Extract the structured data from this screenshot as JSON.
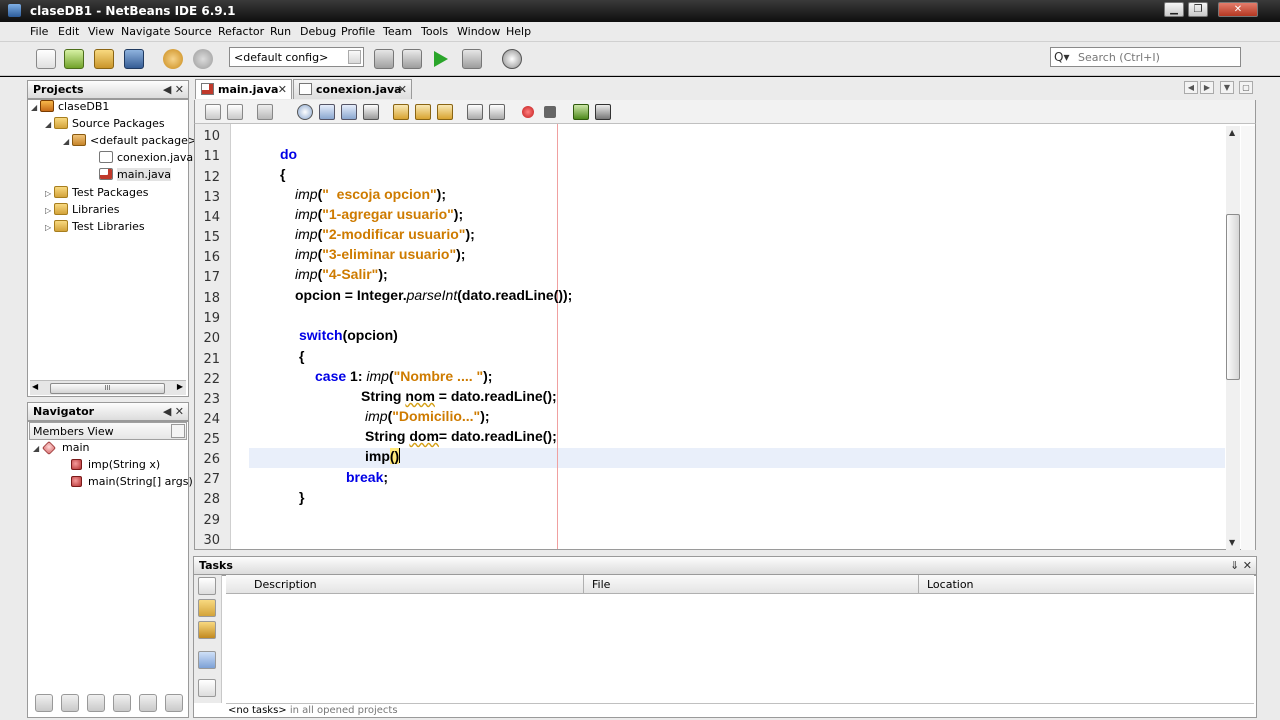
{
  "window": {
    "title": "claseDB1 - NetBeans IDE 6.9.1",
    "minimize": "▁",
    "maximize": "❐",
    "close": "✕"
  },
  "menu": [
    "File",
    "Edit",
    "View",
    "Navigate",
    "Source",
    "Refactor",
    "Run",
    "Debug",
    "Profile",
    "Team",
    "Tools",
    "Window",
    "Help"
  ],
  "toolbar": {
    "config": "<default config>",
    "search_placeholder": "Search (Ctrl+I)",
    "search_glyph": "Q▾"
  },
  "projects": {
    "title": "Projects",
    "tree": [
      {
        "label": "claseDB1",
        "exp": "◢"
      },
      {
        "label": "Source Packages",
        "exp": "◢"
      },
      {
        "label": "<default package>",
        "exp": "◢"
      },
      {
        "label": "conexion.java",
        "exp": ""
      },
      {
        "label": "main.java",
        "exp": ""
      },
      {
        "label": "Test Packages",
        "exp": "▷"
      },
      {
        "label": "Libraries",
        "exp": "▷"
      },
      {
        "label": "Test Libraries",
        "exp": "▷"
      }
    ],
    "scroll_grip": "III"
  },
  "navigator": {
    "title": "Navigator",
    "view": "Members View",
    "items": [
      {
        "label": "main",
        "exp": "◢"
      },
      {
        "label": "imp(String x)",
        "exp": ""
      },
      {
        "label": "main(String[] args)",
        "exp": ""
      }
    ]
  },
  "panel_controls": "◀ ✕",
  "editor": {
    "tabs": [
      {
        "label": "main.java",
        "close": "✕"
      },
      {
        "label": "conexion.java",
        "close": "✕"
      }
    ],
    "tab_nav": [
      "◀",
      "▶",
      "▼",
      "▢"
    ],
    "line_numbers": [
      "10",
      "11",
      "12",
      "13",
      "14",
      "15",
      "16",
      "17",
      "18",
      "19",
      "20",
      "21",
      "22",
      "23",
      "24",
      "25",
      "26",
      "27",
      "28",
      "29",
      "30"
    ],
    "code": {
      "l11": {
        "kw": "do"
      },
      "l12": {
        "text": "{"
      },
      "l13": {
        "fn": "imp",
        "open": "(",
        "str": "\"  escoja opcion\"",
        "close": ");"
      },
      "l14": {
        "fn": "imp",
        "open": "(",
        "str": "\"1-agregar usuario\"",
        "close": ");"
      },
      "l15": {
        "fn": "imp",
        "open": "(",
        "str": "\"2-modificar usuario\"",
        "close": ");"
      },
      "l16": {
        "fn": "imp",
        "open": "(",
        "str": "\"3-eliminar usuario\"",
        "close": ");"
      },
      "l17": {
        "fn": "imp",
        "open": "(",
        "str": "\"4-Salir\"",
        "close": ");"
      },
      "l18": {
        "pre": "opcion = Integer.",
        "fn": "parseInt",
        "post": "(dato.readLine());"
      },
      "l20": {
        "kw": "switch",
        "post": "(opcion)"
      },
      "l21": {
        "text": "{"
      },
      "l22": {
        "kw": "case",
        "num": " 1: ",
        "fn": "imp",
        "open": "(",
        "str": "\"Nombre .... \"",
        "close": ");"
      },
      "l23": {
        "pre": "String ",
        "var": "nom",
        "post": " = dato.readLine();"
      },
      "l24": {
        "fn": "imp",
        "open": "(",
        "str": "\"Domicilio...\"",
        "close": ");"
      },
      "l25": {
        "pre": "String ",
        "var": "dom",
        "post": "= dato.readLine();"
      },
      "l26": {
        "pre": "imp",
        "paren": "()"
      },
      "l27": {
        "kw": "break",
        "post": ";"
      },
      "l28": {
        "text": "}"
      }
    },
    "scroll_up": "▲",
    "scroll_down": "▼"
  },
  "tasks": {
    "title": "Tasks",
    "columns": [
      "Description",
      "File",
      "Location"
    ],
    "status_bold": "<no tasks>",
    "status_rest": " in all opened projects",
    "controls": "⇓ ✕"
  }
}
